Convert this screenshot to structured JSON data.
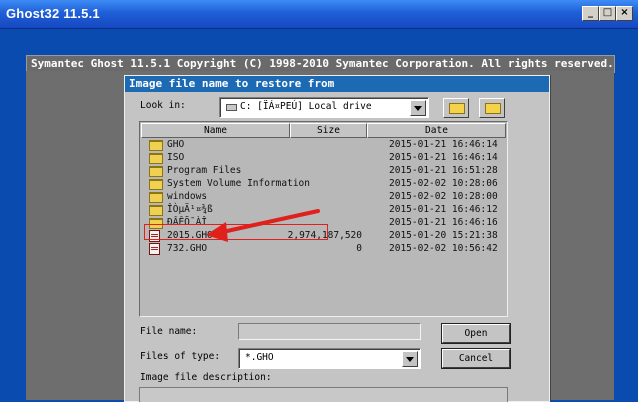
{
  "window": {
    "title": "Ghost32 11.5.1",
    "controls": [
      "_",
      "□",
      "×"
    ]
  },
  "ghost": {
    "banner": "Symantec Ghost 11.5.1   Copyright (C) 1998-2010 Symantec Corporation. All rights reserved."
  },
  "dialog": {
    "title": "Image file name to restore from",
    "look_in_label": "Look in:",
    "look_in_value": "C: [ÏÁ¤PEÚ] Local drive",
    "columns": {
      "name": "Name",
      "size": "Size",
      "date": "Date"
    },
    "files": [
      {
        "name": "GHO",
        "size": "",
        "date": "2015-01-21 16:46:14",
        "type": "folder"
      },
      {
        "name": "ISO",
        "size": "",
        "date": "2015-01-21 16:46:14",
        "type": "folder"
      },
      {
        "name": "Program Files",
        "size": "",
        "date": "2015-01-21 16:51:28",
        "type": "folder"
      },
      {
        "name": "System Volume Information",
        "size": "",
        "date": "2015-02-02 10:28:06",
        "type": "folder"
      },
      {
        "name": "windows",
        "size": "",
        "date": "2015-02-02 10:28:00",
        "type": "folder"
      },
      {
        "name": "ÎÒµÄ¹¤¾ß",
        "size": "",
        "date": "2015-01-21 16:46:12",
        "type": "folder"
      },
      {
        "name": "ÐÂÊÕ¯ÀÎ",
        "size": "",
        "date": "2015-01-21 16:46:16",
        "type": "folder"
      },
      {
        "name": "2015.GHO",
        "size": "2,974,187,520",
        "date": "2015-01-20 15:21:38",
        "type": "gho"
      },
      {
        "name": "732.GHO",
        "size": "0",
        "date": "2015-02-02 10:56:42",
        "type": "gho"
      }
    ],
    "file_name_label": "File name:",
    "file_name_value": "",
    "files_of_type_label": "Files of type:",
    "files_of_type_value": "*.GHO",
    "open_label": "Open",
    "cancel_label": "Cancel",
    "image_description_label": "Image file description:"
  },
  "colors": {
    "annotation": "#e0201a",
    "dialog_title": "#1c6ab4",
    "desktop": "#0a4bb0"
  }
}
